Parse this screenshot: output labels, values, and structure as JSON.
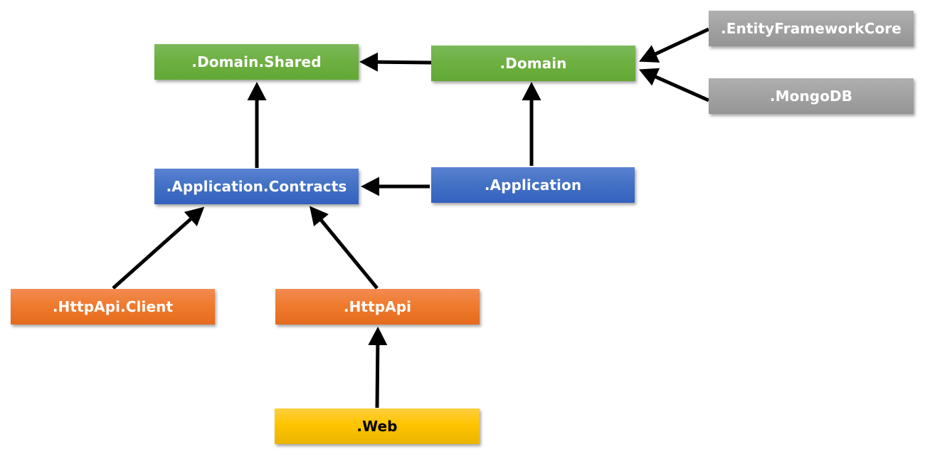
{
  "diagram": {
    "nodes": {
      "domain_shared": {
        "label": ".Domain.Shared",
        "color": "#70ad47"
      },
      "domain": {
        "label": ".Domain",
        "color": "#70ad47"
      },
      "entity_framework_core": {
        "label": ".EntityFrameworkCore",
        "color": "#a5a5a5"
      },
      "mongodb": {
        "label": ".MongoDB",
        "color": "#a5a5a5"
      },
      "application_contracts": {
        "label": ".Application.Contracts",
        "color": "#4472c4"
      },
      "application": {
        "label": ".Application",
        "color": "#4472c4"
      },
      "httpapi_client": {
        "label": ".HttpApi.Client",
        "color": "#ed7d31"
      },
      "httpapi": {
        "label": ".HttpApi",
        "color": "#ed7d31"
      },
      "web": {
        "label": ".Web",
        "color": "#ffc000"
      }
    },
    "edges": [
      {
        "from": "domain",
        "to": "domain_shared"
      },
      {
        "from": "entity_framework_core",
        "to": "domain"
      },
      {
        "from": "mongodb",
        "to": "domain"
      },
      {
        "from": "application_contracts",
        "to": "domain_shared"
      },
      {
        "from": "application",
        "to": "domain"
      },
      {
        "from": "application",
        "to": "application_contracts"
      },
      {
        "from": "httpapi_client",
        "to": "application_contracts"
      },
      {
        "from": "httpapi",
        "to": "application_contracts"
      },
      {
        "from": "web",
        "to": "httpapi"
      }
    ],
    "arrow_color": "#000000"
  }
}
